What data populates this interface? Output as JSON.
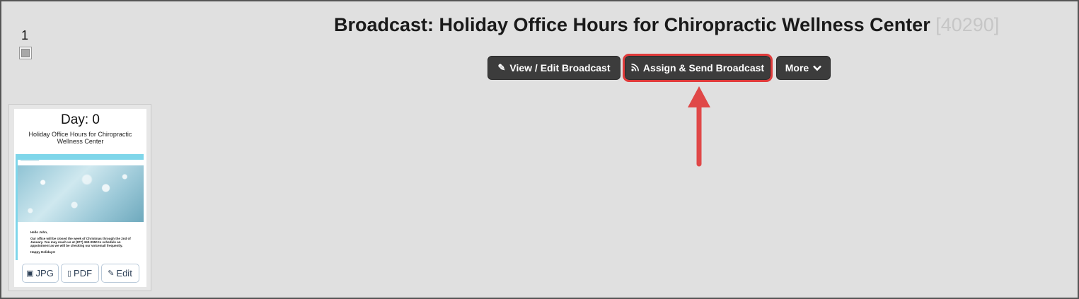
{
  "page": {
    "number": "1"
  },
  "header": {
    "title": "Broadcast: Holiday Office Hours for Chiropractic Wellness Center",
    "id_label": "[40290]"
  },
  "toolbar": {
    "view_edit_label": "View / Edit Broadcast",
    "assign_send_label": "Assign & Send Broadcast",
    "more_label": "More",
    "view_edit_icon": "edit-icon",
    "assign_send_icon": "rss-icon",
    "more_icon": "chevron-down-icon"
  },
  "annotation": {
    "arrow_color": "#e04848",
    "highlight_color": "#e03b3b"
  },
  "card": {
    "day_label": "Day: 0",
    "subtitle": "Holiday Office Hours for Chiropractic Wellness Center",
    "preview": {
      "greeting": "Hello John,",
      "body": "Our office will be closed the week of Christmas through the 2nd of January. You may reach us at (877) 340-0950 to schedule an appointment as we will be checking our voicemail frequently.",
      "closing": "Happy Holidays!"
    },
    "buttons": {
      "jpg": "JPG",
      "pdf": "PDF",
      "edit": "Edit"
    }
  }
}
